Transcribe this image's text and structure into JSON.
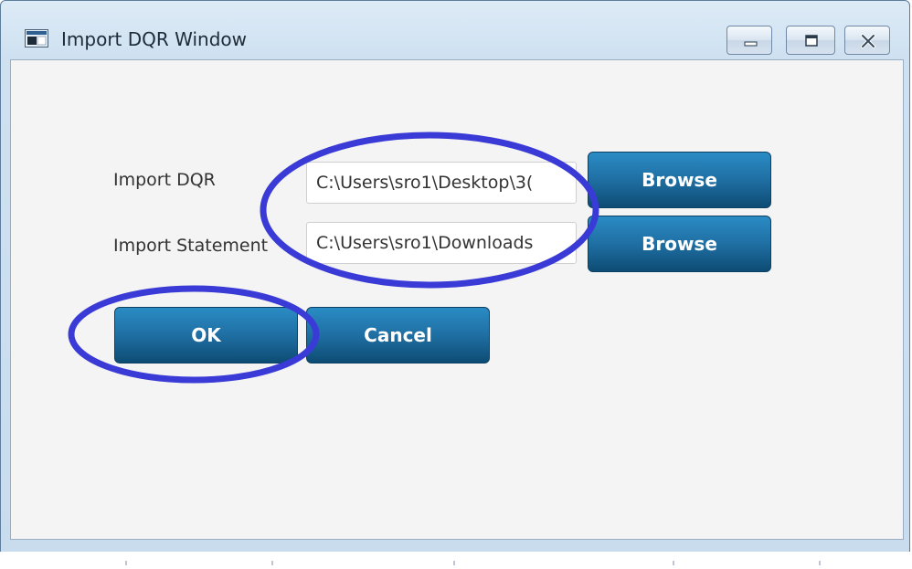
{
  "window": {
    "title": "Import DQR Window",
    "icons": {
      "app": "app-window-icon",
      "minimize": "minimize-icon",
      "maximize": "maximize-icon",
      "close": "close-icon"
    }
  },
  "form": {
    "import_dqr_label": "Import DQR",
    "import_dqr_value": "C:\\Users\\sro1\\Desktop\\3(",
    "import_statement_label": "Import Statement",
    "import_statement_value": "C:\\Users\\sro1\\Downloads",
    "browse_label_1": "Browse",
    "browse_label_2": "Browse"
  },
  "actions": {
    "ok_label": "OK",
    "cancel_label": "Cancel"
  },
  "colors": {
    "button_blue": "#1f6fa3",
    "annotation_ellipse": "#3a3ad6"
  }
}
